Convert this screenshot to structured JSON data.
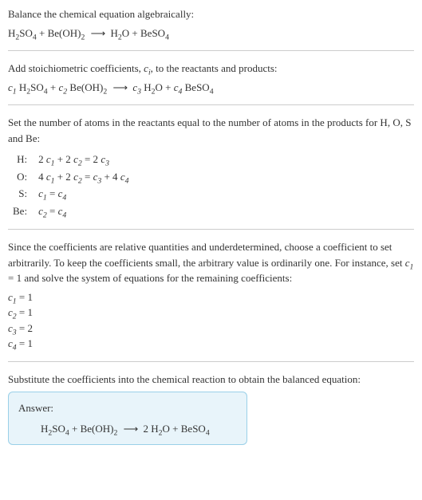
{
  "intro": {
    "line1": "Balance the chemical equation algebraically:"
  },
  "equation_unbalanced": {
    "r1": "H",
    "r1s1": "2",
    "r1b": "SO",
    "r1s2": "4",
    "plus1": " + ",
    "r2": "Be(OH)",
    "r2s1": "2",
    "arrow": "⟶",
    "p1": "H",
    "p1s1": "2",
    "p1b": "O",
    "plus2": " + ",
    "p2": "BeSO",
    "p2s1": "4"
  },
  "step_coeff": {
    "text_a": "Add stoichiometric coefficients, ",
    "ci": "c",
    "cisub": "i",
    "text_b": ", to the reactants and products:"
  },
  "equation_coeff": {
    "c1": "c",
    "c1s": "1",
    "c2": "c",
    "c2s": "2",
    "c3": "c",
    "c3s": "3",
    "c4": "c",
    "c4s": "4"
  },
  "step_atoms": {
    "text": "Set the number of atoms in the reactants equal to the number of atoms in the products for H, O, S and Be:"
  },
  "atom_rows": {
    "h_label": "H:",
    "o_label": "O:",
    "s_label": "S:",
    "be_label": "Be:"
  },
  "atom_eq": {
    "h_a": "2",
    "h_b": " + 2",
    "h_c": " = 2",
    "o_a": "4",
    "o_b": " + 2",
    "o_c": " = ",
    "o_d": " + 4",
    "s_a": " = ",
    "be_a": " = "
  },
  "step_solve": {
    "text_a": "Since the coefficients are relative quantities and underdetermined, choose a coefficient to set arbitrarily. To keep the coefficients small, the arbitrary value is ordinarily one. For instance, set ",
    "set_c": "c",
    "set_cs": "1",
    "text_b": " = 1 and solve the system of equations for the remaining coefficients:"
  },
  "coef_values": {
    "v1": " = 1",
    "v2": " = 1",
    "v3": " = 2",
    "v4": " = 1"
  },
  "step_final": {
    "text": "Substitute the coefficients into the chemical reaction to obtain the balanced equation:"
  },
  "answer": {
    "label": "Answer:",
    "coef_p1": "2 "
  }
}
